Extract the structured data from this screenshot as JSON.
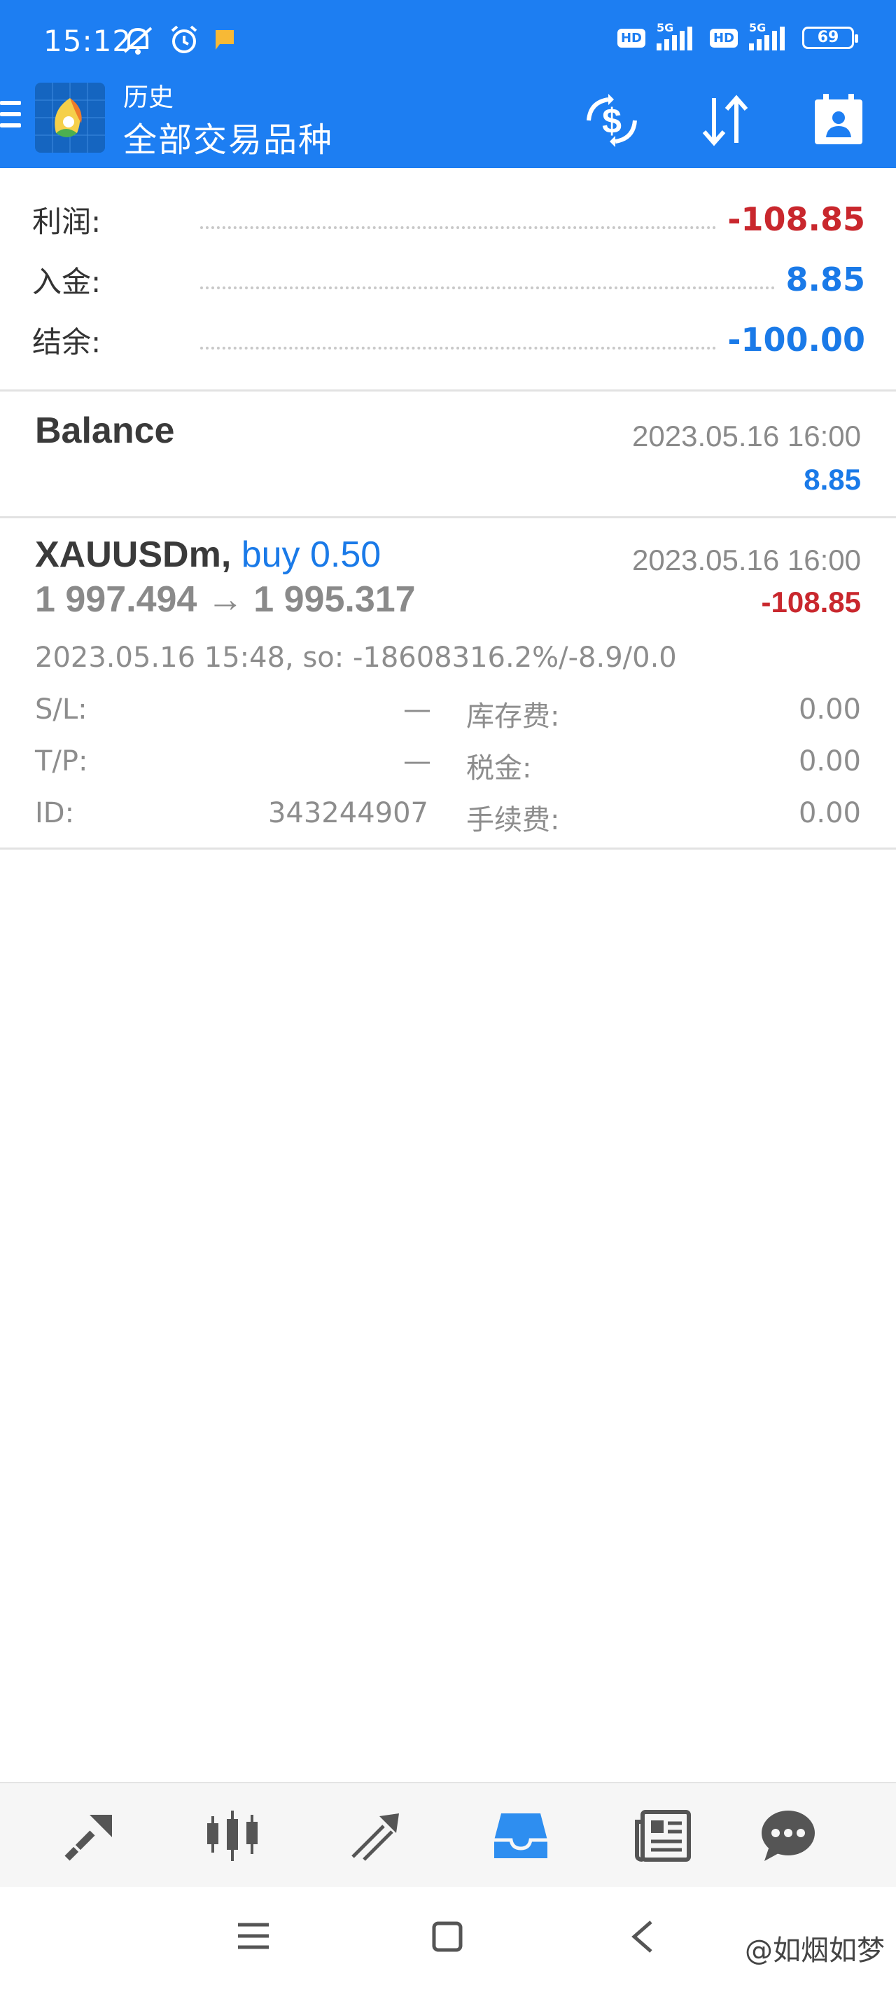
{
  "status_bar": {
    "time": "15:12",
    "network_label": "5G",
    "hd_label": "HD",
    "battery": "69"
  },
  "app_bar": {
    "subtitle": "历史",
    "title": "全部交易品种"
  },
  "summary": {
    "profit_label": "利润:",
    "profit_value": "-108.85",
    "deposit_label": "入金:",
    "deposit_value": "8.85",
    "balance_label": "结余:",
    "balance_value": "-100.00"
  },
  "balance_entry": {
    "title": "Balance",
    "datetime": "2023.05.16 16:00",
    "amount": "8.85"
  },
  "trade_entry": {
    "symbol": "XAUUSDm,",
    "direction": "buy 0.50",
    "datetime": "2023.05.16 16:00",
    "price_open": "1 997.494",
    "arrow": "→",
    "price_close": "1 995.317",
    "profit": "-108.85",
    "open_info": "2023.05.16 15:48, so: -18608316.2%/-8.9/0.0",
    "sl_label": "S/L:",
    "sl_value": "—",
    "tp_label": "T/P:",
    "tp_value": "—",
    "id_label": "ID:",
    "id_value": "343244907",
    "swap_label": "库存费:",
    "swap_value": "0.00",
    "tax_label": "税金:",
    "tax_value": "0.00",
    "commission_label": "手续费:",
    "commission_value": "0.00"
  },
  "bottom_nav": {
    "items": [
      "quotes-icon",
      "chart-icon",
      "trade-icon",
      "history-icon",
      "news-icon",
      "chat-icon"
    ],
    "active": "history-icon",
    "active_color": "#2e8ef0"
  },
  "watermark": "@如烟如梦",
  "colors": {
    "primary": "#1d7ef2",
    "loss": "#c9272d",
    "gain": "#1a7ae8"
  }
}
